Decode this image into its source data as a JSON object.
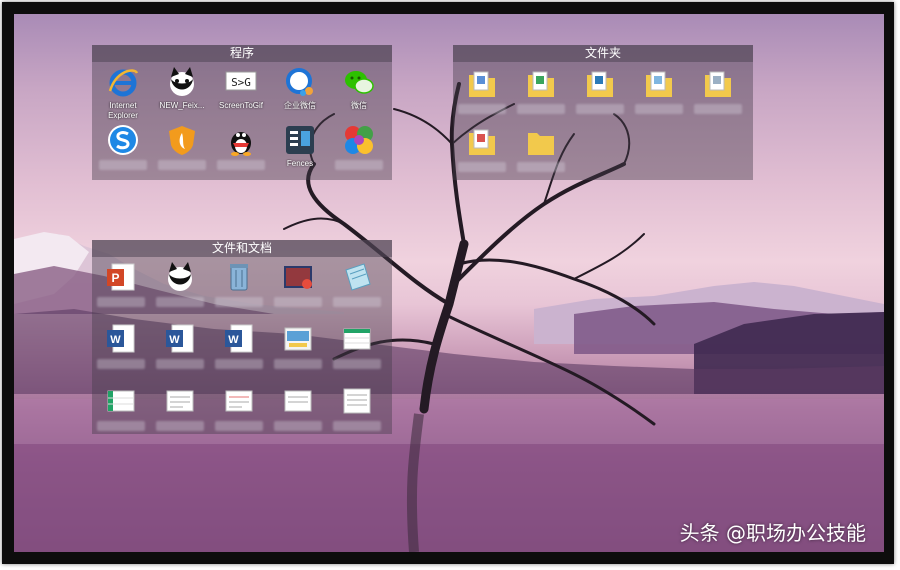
{
  "fences": {
    "programs": {
      "title": "程序",
      "icons": [
        {
          "label": "Internet Explorer",
          "icon": "ie-icon"
        },
        {
          "label": "NEW_Feix...",
          "icon": "cat-app-icon"
        },
        {
          "label": "ScreenToGif",
          "icon": "screentogif-icon"
        },
        {
          "label": "企业微信",
          "icon": "wecom-icon"
        },
        {
          "label": "微信",
          "icon": "wechat-icon"
        },
        {
          "label": "",
          "icon": "sogou-icon"
        },
        {
          "label": "",
          "icon": "shield-app-icon"
        },
        {
          "label": "",
          "icon": "qq-icon"
        },
        {
          "label": "Fences",
          "icon": "fences-icon"
        },
        {
          "label": "",
          "icon": "pinwheel-icon"
        }
      ]
    },
    "folders": {
      "title": "文件夹",
      "icons": [
        {
          "label": "",
          "icon": "folder-icon"
        },
        {
          "label": "",
          "icon": "folder-icon"
        },
        {
          "label": "",
          "icon": "folder-icon"
        },
        {
          "label": "",
          "icon": "folder-icon"
        },
        {
          "label": "",
          "icon": "folder-icon"
        },
        {
          "label": "",
          "icon": "folder-icon"
        },
        {
          "label": "",
          "icon": "folder-icon"
        }
      ]
    },
    "docs": {
      "title": "文件和文档",
      "icons": [
        {
          "label": "",
          "icon": "powerpoint-icon"
        },
        {
          "label": "",
          "icon": "cat-app-icon"
        },
        {
          "label": "",
          "icon": "recycle-bin-icon"
        },
        {
          "label": "",
          "icon": "image-file-icon"
        },
        {
          "label": "",
          "icon": "notepad-icon"
        },
        {
          "label": "",
          "icon": "word-doc-icon"
        },
        {
          "label": "",
          "icon": "word-doc-icon"
        },
        {
          "label": "",
          "icon": "word-doc-icon"
        },
        {
          "label": "",
          "icon": "document-icon"
        },
        {
          "label": "",
          "icon": "spreadsheet-icon"
        },
        {
          "label": "",
          "icon": "spreadsheet-icon"
        },
        {
          "label": "",
          "icon": "document-icon"
        },
        {
          "label": "",
          "icon": "document-icon"
        },
        {
          "label": "",
          "icon": "document-icon"
        },
        {
          "label": "",
          "icon": "document-icon"
        }
      ]
    }
  },
  "watermark": "头条 @职场办公技能",
  "colors": {
    "fence_bg": "#463c4b",
    "accent_blue": "#1e74d6",
    "word_blue": "#2b579a",
    "ppt_orange": "#d24726",
    "folder_yellow": "#f2c94c"
  }
}
